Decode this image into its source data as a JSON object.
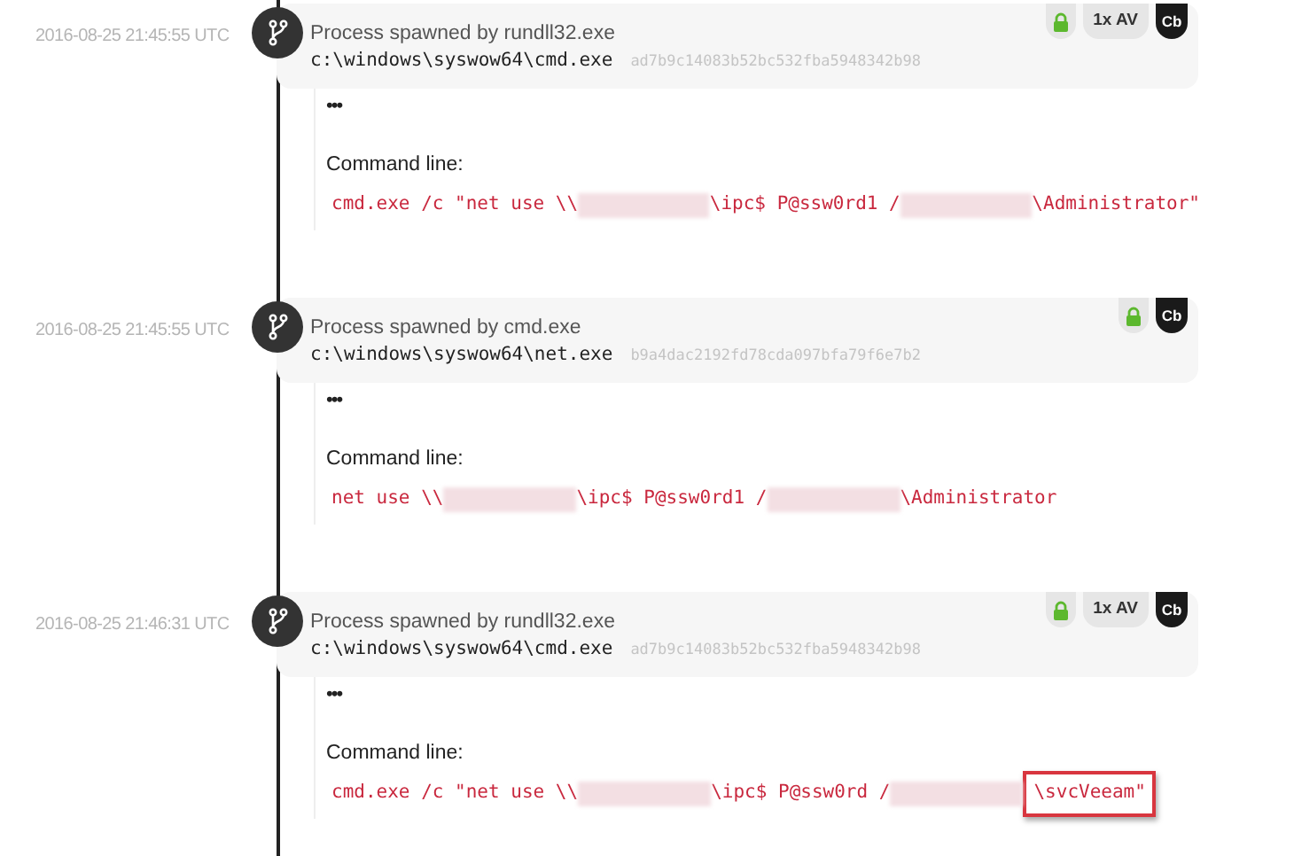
{
  "events": [
    {
      "timestamp": "2016-08-25 21:45:55 UTC",
      "title": "Process spawned by rundll32.exe",
      "path": "c:\\windows\\syswow64\\cmd.exe",
      "hash": "ad7b9c14083b52bc532fba5948342b98",
      "badges": [
        {
          "kind": "lock"
        },
        {
          "kind": "text",
          "text": "1x AV"
        },
        {
          "kind": "dark",
          "text": "Cb"
        }
      ],
      "more": "•••",
      "command_label": "Command line:",
      "command_parts": [
        {
          "kind": "text",
          "text": "cmd.exe /c \"net use \\\\",
          "highlighted": false
        },
        {
          "kind": "redacted"
        },
        {
          "kind": "text",
          "text": "\\ipc$ P@ssw0rd1 /",
          "highlighted": false
        },
        {
          "kind": "redacted"
        },
        {
          "kind": "text",
          "text": "\\Administrator\"",
          "highlighted": false
        }
      ]
    },
    {
      "timestamp": "2016-08-25 21:45:55 UTC",
      "title": "Process spawned by cmd.exe",
      "path": "c:\\windows\\syswow64\\net.exe",
      "hash": "b9a4dac2192fd78cda097bfa79f6e7b2",
      "badges": [
        {
          "kind": "lock"
        },
        {
          "kind": "dark",
          "text": "Cb"
        }
      ],
      "more": "•••",
      "command_label": "Command line:",
      "command_parts": [
        {
          "kind": "text",
          "text": "net use \\\\",
          "highlighted": false
        },
        {
          "kind": "redacted"
        },
        {
          "kind": "text",
          "text": "\\ipc$ P@ssw0rd1 /",
          "highlighted": false
        },
        {
          "kind": "redacted"
        },
        {
          "kind": "text",
          "text": "\\Administrator",
          "highlighted": false
        }
      ]
    },
    {
      "timestamp": "2016-08-25 21:46:31 UTC",
      "title": "Process spawned by rundll32.exe",
      "path": "c:\\windows\\syswow64\\cmd.exe",
      "hash": "ad7b9c14083b52bc532fba5948342b98",
      "badges": [
        {
          "kind": "lock"
        },
        {
          "kind": "text",
          "text": "1x AV"
        },
        {
          "kind": "dark",
          "text": "Cb"
        }
      ],
      "more": "•••",
      "command_label": "Command line:",
      "command_parts": [
        {
          "kind": "text",
          "text": "cmd.exe /c \"net use \\\\",
          "highlighted": false
        },
        {
          "kind": "redacted"
        },
        {
          "kind": "text",
          "text": "\\ipc$ P@ssw0rd /",
          "highlighted": false
        },
        {
          "kind": "redacted"
        },
        {
          "kind": "text",
          "text": "\\svcVeeam\"",
          "highlighted": true
        }
      ]
    }
  ]
}
